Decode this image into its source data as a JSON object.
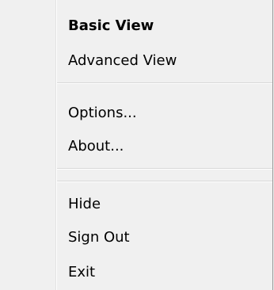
{
  "menu": {
    "items": [
      {
        "label": "Basic View",
        "default": true
      },
      {
        "label": "Advanced View"
      },
      {
        "label": "Options..."
      },
      {
        "label": "About..."
      },
      {
        "label": "Hide"
      },
      {
        "label": "Sign Out"
      },
      {
        "label": "Exit"
      }
    ]
  },
  "colors": {
    "background": "#f0f0f0",
    "separator": "#d7d7d7",
    "border": "#979797"
  }
}
